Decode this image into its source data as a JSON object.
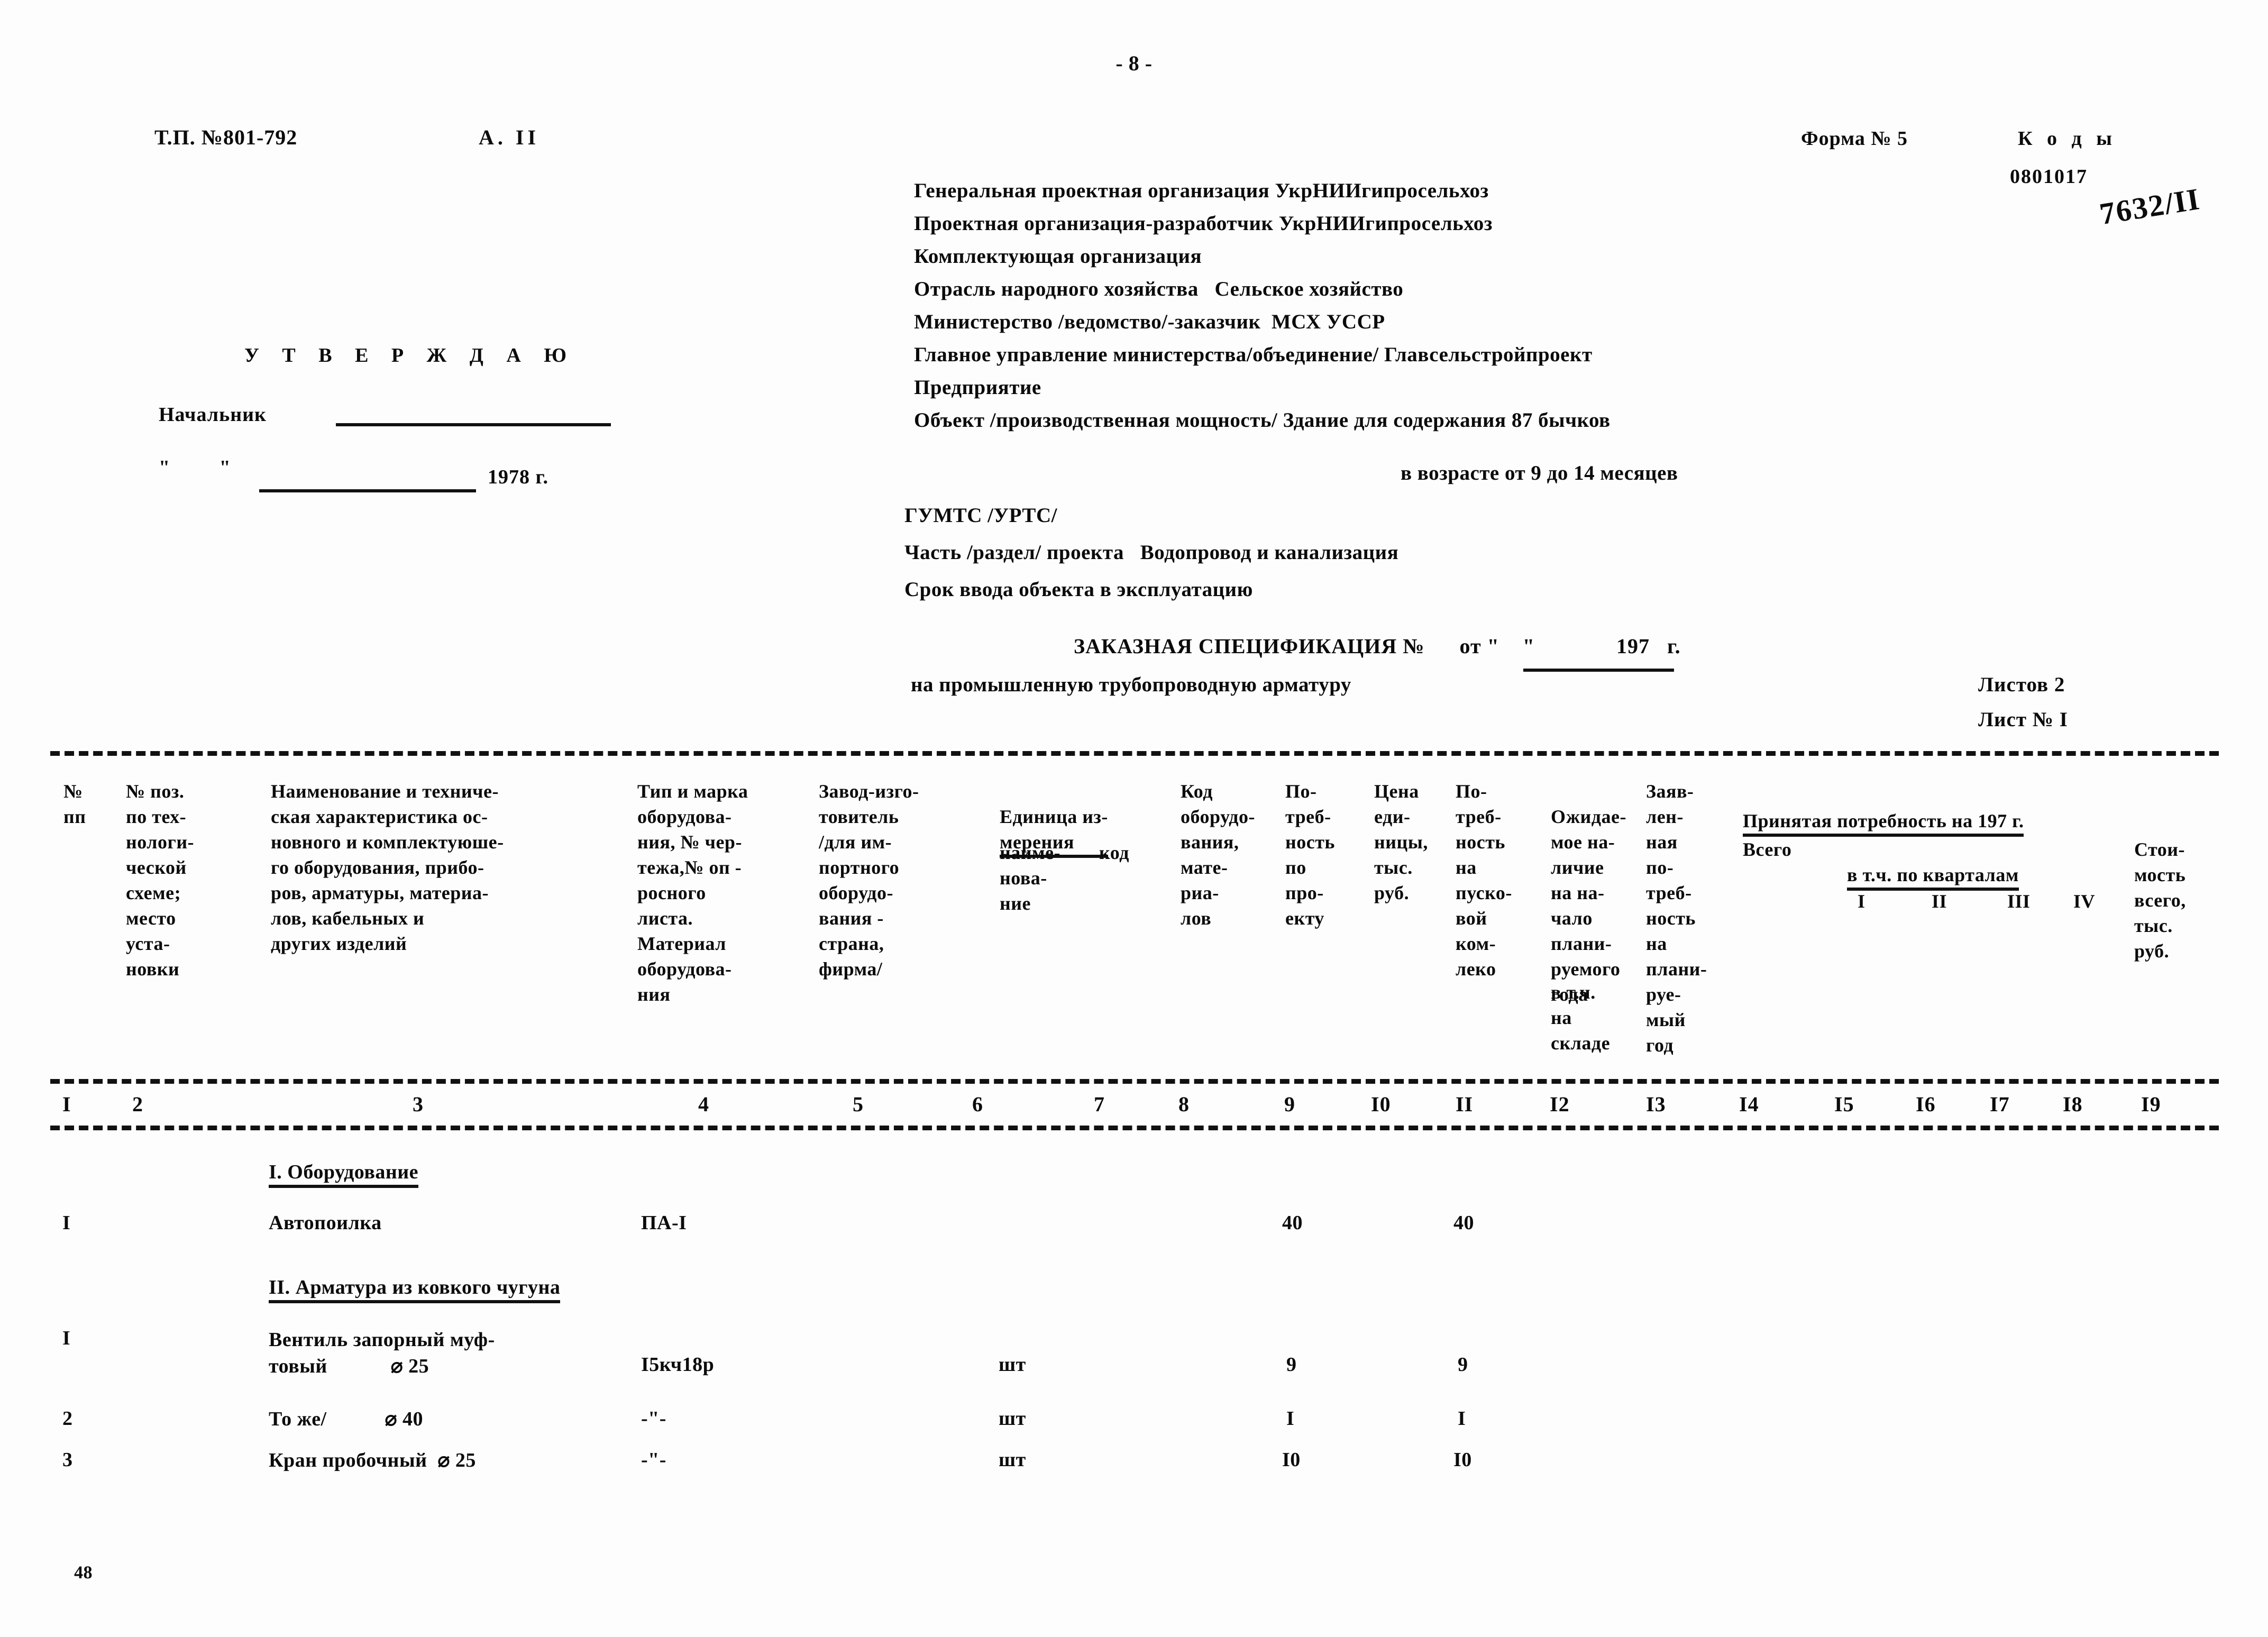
{
  "page": {
    "number": "- 8 -",
    "tp_number": "Т.П. №801-792",
    "album": "А.  II",
    "bottom_mark": "48"
  },
  "form": {
    "form_label": "Форма № 5",
    "codes_label": "К о д ы",
    "code_value": "0801017",
    "handwritten": "7632/II"
  },
  "approval": {
    "title": "У Т В Е Р Ж Д А Ю",
    "chief_label": "Начальник",
    "date_quotes": "\"  \"",
    "year": "1978 г."
  },
  "org_info": {
    "rows": [
      "Генеральная проектная организация УкрНИИгипросельхоз",
      "Проектная организация-разработчик УкрНИИгипросельхоз",
      "Комплектующая организация",
      "Отрасль народного хозяйства   Сельское хозяйство",
      "Министерство /ведомство/-заказчик  МСХ УССР",
      "Главное управление министерства/объединение/ Главсельстройпроект",
      "Предприятие",
      "Объект /производственная мощность/ Здание для содержания 87 бычков"
    ],
    "object_line2": "в возрасте от 9 до 14 месяцев",
    "gumts": "ГУМТС /УРТС/",
    "part": "Часть /раздел/ проекта   Водопровод и канализация",
    "commissioning": "Срок ввода объекта в эксплуатацию"
  },
  "spec": {
    "title": "ЗАКАЗНАЯ СПЕЦИФИКАЦИЯ №      от \"    \"              197   г.",
    "subtitle": "на промышленную трубопроводную арматуру",
    "sheets_total": "Листов 2",
    "sheet_current": "Лист № I"
  },
  "table": {
    "headers": [
      "№\nпп",
      "№ поз.\nпо тех-\nнологи-\nческой\nсхеме;\nместо\nуста-\nновки",
      "Наименование и техниче-\nская характеристика ос-\nновного и комплектуюше-\nго оборудования, прибо-\nров, арматуры, материа-\nлов, кабельных и\nдругих изделий",
      "Тип и марка\nоборудова-\nния, № чер-\nтежа,№ оп -\nросного\nлиста.\nМатериал\nоборудова-\nния",
      "Завод-изго-\nтовитель\n/для им-\nпортного\nоборудо-\nвания -\nстрана,\nфирма/",
      "Единица из-\nмерения",
      "наиме-\nнова-\nние",
      "код",
      "Код\nоборудо-\nвания,\nмате-\nриа-\nлов",
      "По-\nтреб-\nность\nпо\nпро-\nекту",
      "Цена\nеди-\nницы,\nтыс.\nруб.",
      "По-\nтреб-\nность\nна\nпуско-\nвой\nком-\nлеко",
      "Ожидае-\nмое на-\nличие\nна на-\nчало\nплани-\nруемого\nгода",
      "в т.ч.\nна\nскладе",
      "Заяв-\nлен-\nная\nпо-\nтреб-\nность\nна\nплани-\nруе-\nмый\nгод",
      "Принятая потребность на 197  г.",
      "Всего",
      "в т.ч. по кварталам",
      "I",
      "II",
      "III",
      "IV",
      "Стои-\nмость\nвсего,\nтыс.\nруб."
    ],
    "column_numbers": [
      "I",
      "2",
      "3",
      "4",
      "5",
      "6",
      "7",
      "8",
      "9",
      "I0",
      "II",
      "I2",
      "I3",
      "I4",
      "I5",
      "I6",
      "I7",
      "I8",
      "I9"
    ],
    "sections": [
      {
        "title": "I. Оборудование",
        "rows": [
          {
            "no": "I",
            "name": "Автопоилка",
            "type": "ПА-I",
            "unit": "",
            "need_project": "40",
            "need_startup": "40"
          }
        ]
      },
      {
        "title": "II. Арматура из ковкого чугуна",
        "rows": [
          {
            "no": "I",
            "name": "Вентиль запорный муф-\nтовый            ⌀ 25",
            "type": "I5кч18р",
            "unit": "шт",
            "need_project": "9",
            "need_startup": "9"
          },
          {
            "no": "2",
            "name": "То же/           ⌀ 40",
            "type": "-\"-",
            "unit": "шт",
            "need_project": "I",
            "need_startup": "I"
          },
          {
            "no": "3",
            "name": "Кран пробочный  ⌀ 25",
            "type": "-\"-",
            "unit": "шт",
            "need_project": "I0",
            "need_startup": "I0"
          }
        ]
      }
    ]
  }
}
